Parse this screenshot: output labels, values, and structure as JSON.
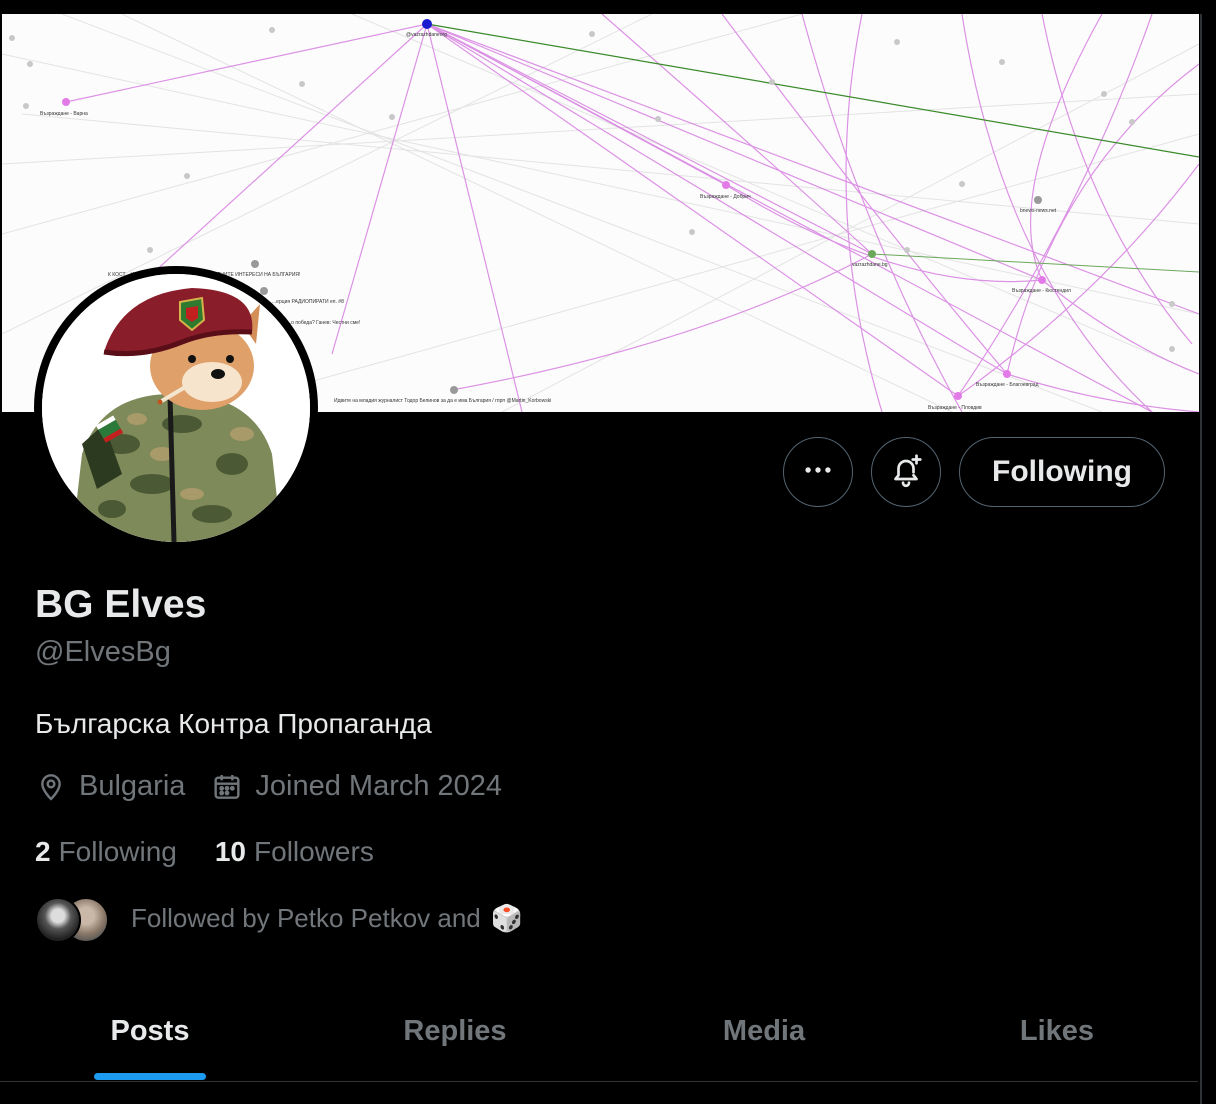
{
  "banner": {
    "graph_labels": [
      "@vazrazhdaneorg",
      "Възраждане - Варна",
      "Възраждане - Добрич",
      "bnews-news.net",
      "vazrazhdane.bg",
      "Възраждане - Кюстендил",
      "К КОСТ... ИАТА) ЩЕ ОТСТОЯВАМЕ НАЦИОНАЛНИТЕ ИНТЕРЕСИ НА БЪЛГАРИЯ!",
      "...ерция РАДИОПИРАТИ еп. #8",
      "...о победа? Ганев: Честни сме!",
      "Идвите на младия журналист Тодор Белинов за да е има България / гпрп @Martin_Korbowski",
      "Възраждане - Благоевград",
      "Възраждане - Пловдив"
    ]
  },
  "actions": {
    "more_icon": "more-horizontal-icon",
    "notify_icon": "bell-plus-icon",
    "follow_label": "Following"
  },
  "profile": {
    "name": "BG Elves",
    "handle": "@ElvesBg",
    "bio": "Българска Контра Пропаганда",
    "location": "Bulgaria",
    "joined": "Joined March 2024",
    "following_count": "2",
    "following_label": "Following",
    "followers_count": "10",
    "followers_label": "Followers",
    "followed_by": "Followed by Petko Petkov and",
    "followed_by_emoji": "🎲"
  },
  "tabs": [
    {
      "label": "Posts",
      "active": true
    },
    {
      "label": "Replies",
      "active": false
    },
    {
      "label": "Media",
      "active": false
    },
    {
      "label": "Likes",
      "active": false
    }
  ],
  "colors": {
    "background": "#000000",
    "text_primary": "#e7e9ea",
    "text_secondary": "#71767b",
    "accent": "#1d9bf0",
    "border": "#536471"
  }
}
